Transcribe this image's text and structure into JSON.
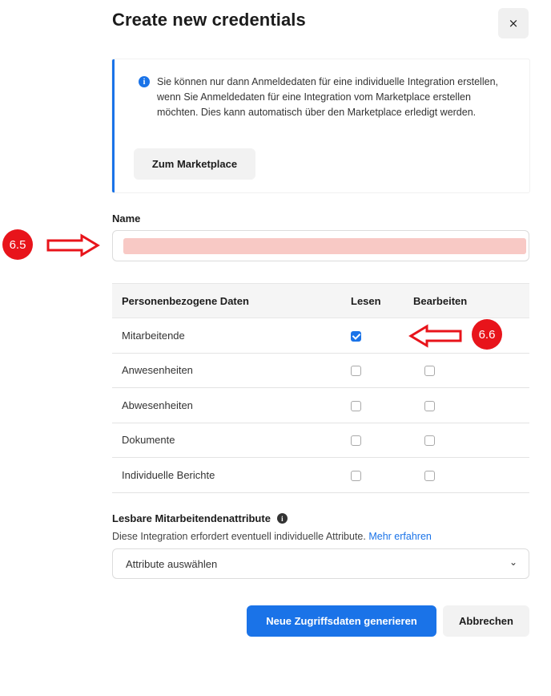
{
  "dialog": {
    "title": "Create new credentials",
    "close_label": "×",
    "close_icon": "close-icon"
  },
  "info": {
    "icon": "info-icon",
    "icon_glyph": "i",
    "text": "Sie können nur dann Anmeldedaten für eine individuelle Integration erstellen, wenn Sie Anmeldedaten für eine Integration vom Marketplace erstellen möchten. Dies kann automatisch über den Marketplace erledigt werden.",
    "button_label": "Zum Marketplace",
    "accent_color": "#1a73e8"
  },
  "name_field": {
    "label": "Name",
    "value_redacted": true
  },
  "annotations": {
    "step_1": "6.5",
    "step_2": "6.6",
    "color": "#e8141b"
  },
  "permissions": {
    "headers": [
      "Personenbezogene Daten",
      "Lesen",
      "Bearbeiten"
    ],
    "rows": [
      {
        "label": "Mitarbeitende",
        "lesen": true,
        "bearbeiten": null
      },
      {
        "label": "Anwesenheiten",
        "lesen": false,
        "bearbeiten": false
      },
      {
        "label": "Abwesenheiten",
        "lesen": false,
        "bearbeiten": false
      },
      {
        "label": "Dokumente",
        "lesen": false,
        "bearbeiten": false
      },
      {
        "label": "Individuelle Berichte",
        "lesen": false,
        "bearbeiten": false
      }
    ]
  },
  "attributes": {
    "label": "Lesbare Mitarbeitendenattribute",
    "info_glyph": "i",
    "description": "Diese Integration erfordert eventuell individuelle Attribute.",
    "link": "Mehr erfahren",
    "select_placeholder": "Attribute auswählen",
    "chevron": "⌄"
  },
  "actions": {
    "primary_label": "Neue Zugriffsdaten generieren",
    "secondary_label": "Abbrechen",
    "primary_color": "#1a73e8"
  }
}
